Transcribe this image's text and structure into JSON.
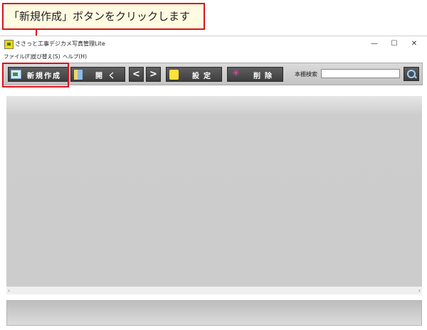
{
  "callout": {
    "text": "「新規作成」ボタンをクリックします"
  },
  "window": {
    "title": "ささっと工事デジカメ写真管理Lite",
    "controls": {
      "minimize": "—",
      "maximize": "☐",
      "close": "✕"
    }
  },
  "menu": {
    "items": [
      "ファイル(F)",
      "並び替え(S)",
      "ヘルプ(H)"
    ]
  },
  "toolbar": {
    "new_label": "新規作成",
    "open_label": "開く",
    "prev_label": "<",
    "next_label": ">",
    "settings_label": "設定",
    "delete_label": "削除",
    "delete_icon_glyph": "✳",
    "search_label": "本棚検索",
    "search_value": ""
  },
  "scrollbar": {
    "left_arrow": "‹",
    "right_arrow": "›"
  },
  "colors": {
    "accent": "#d9121d",
    "button_bg": "#4a4a4a",
    "content_bg": "#cccccc"
  }
}
